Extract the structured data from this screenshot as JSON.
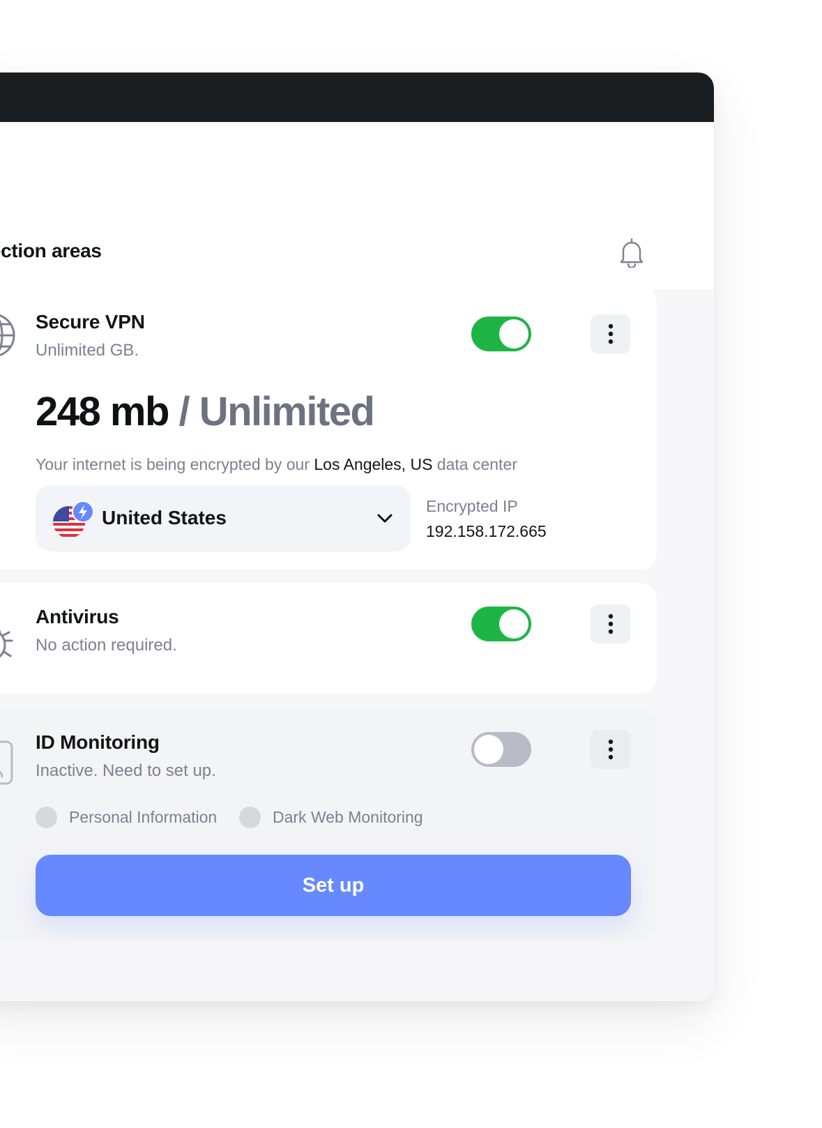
{
  "header": {
    "section_title": "otection areas",
    "notifications_icon": "bell-icon"
  },
  "cards": {
    "vpn": {
      "icon": "globe-icon",
      "title": "Secure VPN",
      "subtitle": "Unlimited GB.",
      "enabled": true,
      "usage_used": "248 mb",
      "usage_total": " / Unlimited",
      "info_prefix": "Your internet is being encrypted by our ",
      "info_city": "Los Angeles, US",
      "info_suffix": " data center",
      "location": {
        "flag_icon": "us-flag-icon",
        "badge_icon": "lightning-bolt-icon",
        "selected": "United States",
        "dropdown_icon": "chevron-down-icon"
      },
      "ip_label": "Encrypted IP",
      "ip_value": "192.158.172.665"
    },
    "antivirus": {
      "icon": "bug-icon",
      "title": "Antivirus",
      "subtitle": "No action required.",
      "enabled": true
    },
    "id_monitoring": {
      "icon": "id-badge-icon",
      "title": "ID Monitoring",
      "subtitle": "Inactive. Need to set up.",
      "enabled": false,
      "chips": [
        "Personal Information",
        "Dark Web Monitoring"
      ],
      "setup_label": "Set up"
    }
  },
  "colors": {
    "accent": "#6689ff",
    "toggle_on": "#1fb545",
    "toggle_off": "#b7bcc6",
    "titlebar": "#1b1e20"
  }
}
